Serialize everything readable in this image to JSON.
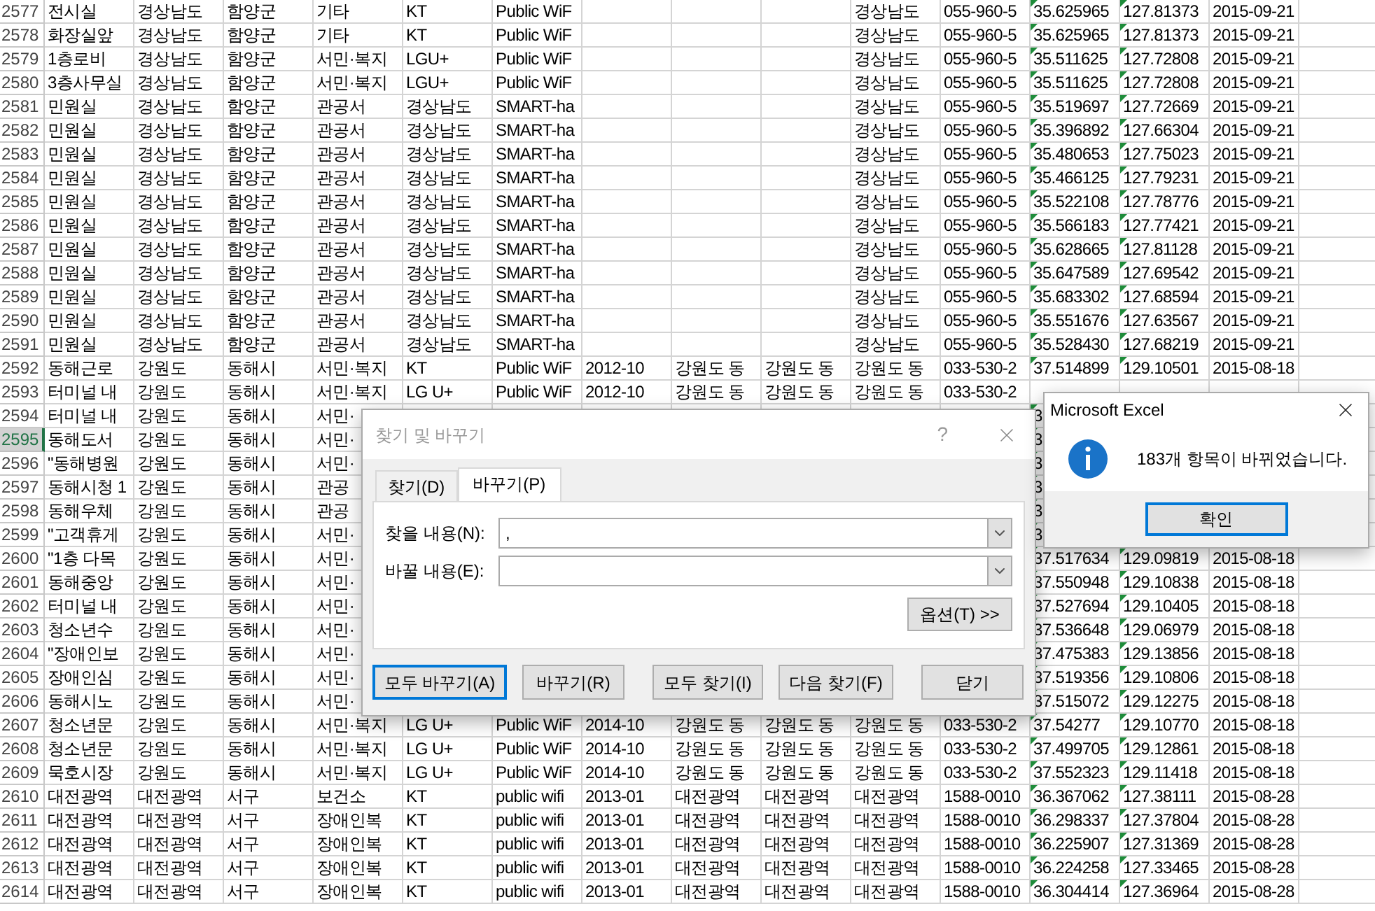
{
  "sheet": {
    "columns": [
      {
        "flagged": false
      },
      {
        "flagged": false
      },
      {
        "flagged": false
      },
      {
        "flagged": false
      },
      {
        "flagged": false
      },
      {
        "flagged": false
      },
      {
        "flagged": false
      },
      {
        "flagged": false
      },
      {
        "flagged": false
      },
      {
        "flagged": false
      },
      {
        "flagged": false
      },
      {
        "flagged": true
      },
      {
        "flagged": true
      },
      {
        "flagged": false
      }
    ],
    "rows": [
      {
        "number": "2577",
        "selected": false,
        "cells": [
          "전시실",
          "경상남도",
          "함양군",
          "기타",
          "KT",
          "Public WiF",
          null,
          null,
          null,
          "경상남도",
          "055-960-5",
          "35.625965",
          "127.81373",
          "2015-09-21"
        ]
      },
      {
        "number": "2578",
        "selected": false,
        "cells": [
          "화장실앞",
          "경상남도",
          "함양군",
          "기타",
          "KT",
          "Public WiF",
          null,
          null,
          null,
          "경상남도",
          "055-960-5",
          "35.625965",
          "127.81373",
          "2015-09-21"
        ]
      },
      {
        "number": "2579",
        "selected": false,
        "cells": [
          "1층로비",
          "경상남도",
          "함양군",
          "서민·복지",
          "LGU+",
          "Public WiF",
          null,
          null,
          null,
          "경상남도",
          "055-960-5",
          "35.511625",
          "127.72808",
          "2015-09-21"
        ]
      },
      {
        "number": "2580",
        "selected": false,
        "cells": [
          "3층사무실",
          "경상남도",
          "함양군",
          "서민·복지",
          "LGU+",
          "Public WiF",
          null,
          null,
          null,
          "경상남도",
          "055-960-5",
          "35.511625",
          "127.72808",
          "2015-09-21"
        ]
      },
      {
        "number": "2581",
        "selected": false,
        "cells": [
          "민원실",
          "경상남도",
          "함양군",
          "관공서",
          "경상남도",
          "SMART-ha",
          null,
          null,
          null,
          "경상남도",
          "055-960-5",
          "35.519697",
          "127.72669",
          "2015-09-21"
        ]
      },
      {
        "number": "2582",
        "selected": false,
        "cells": [
          "민원실",
          "경상남도",
          "함양군",
          "관공서",
          "경상남도",
          "SMART-ha",
          null,
          null,
          null,
          "경상남도",
          "055-960-5",
          "35.396892",
          "127.66304",
          "2015-09-21"
        ]
      },
      {
        "number": "2583",
        "selected": false,
        "cells": [
          "민원실",
          "경상남도",
          "함양군",
          "관공서",
          "경상남도",
          "SMART-ha",
          null,
          null,
          null,
          "경상남도",
          "055-960-5",
          "35.480653",
          "127.75023",
          "2015-09-21"
        ]
      },
      {
        "number": "2584",
        "selected": false,
        "cells": [
          "민원실",
          "경상남도",
          "함양군",
          "관공서",
          "경상남도",
          "SMART-ha",
          null,
          null,
          null,
          "경상남도",
          "055-960-5",
          "35.466125",
          "127.79231",
          "2015-09-21"
        ]
      },
      {
        "number": "2585",
        "selected": false,
        "cells": [
          "민원실",
          "경상남도",
          "함양군",
          "관공서",
          "경상남도",
          "SMART-ha",
          null,
          null,
          null,
          "경상남도",
          "055-960-5",
          "35.522108",
          "127.78776",
          "2015-09-21"
        ]
      },
      {
        "number": "2586",
        "selected": false,
        "cells": [
          "민원실",
          "경상남도",
          "함양군",
          "관공서",
          "경상남도",
          "SMART-ha",
          null,
          null,
          null,
          "경상남도",
          "055-960-5",
          "35.566183",
          "127.77421",
          "2015-09-21"
        ]
      },
      {
        "number": "2587",
        "selected": false,
        "cells": [
          "민원실",
          "경상남도",
          "함양군",
          "관공서",
          "경상남도",
          "SMART-ha",
          null,
          null,
          null,
          "경상남도",
          "055-960-5",
          "35.628665",
          "127.81128",
          "2015-09-21"
        ]
      },
      {
        "number": "2588",
        "selected": false,
        "cells": [
          "민원실",
          "경상남도",
          "함양군",
          "관공서",
          "경상남도",
          "SMART-ha",
          null,
          null,
          null,
          "경상남도",
          "055-960-5",
          "35.647589",
          "127.69542",
          "2015-09-21"
        ]
      },
      {
        "number": "2589",
        "selected": false,
        "cells": [
          "민원실",
          "경상남도",
          "함양군",
          "관공서",
          "경상남도",
          "SMART-ha",
          null,
          null,
          null,
          "경상남도",
          "055-960-5",
          "35.683302",
          "127.68594",
          "2015-09-21"
        ]
      },
      {
        "number": "2590",
        "selected": false,
        "cells": [
          "민원실",
          "경상남도",
          "함양군",
          "관공서",
          "경상남도",
          "SMART-ha",
          null,
          null,
          null,
          "경상남도",
          "055-960-5",
          "35.551676",
          "127.63567",
          "2015-09-21"
        ]
      },
      {
        "number": "2591",
        "selected": false,
        "cells": [
          "민원실",
          "경상남도",
          "함양군",
          "관공서",
          "경상남도",
          "SMART-ha",
          null,
          null,
          null,
          "경상남도",
          "055-960-5",
          "35.528430",
          "127.68219",
          "2015-09-21"
        ]
      },
      {
        "number": "2592",
        "selected": false,
        "cells": [
          "동해근로",
          "강원도",
          "동해시",
          "서민·복지",
          "KT",
          "Public WiF",
          "2012-10",
          "강원도 동",
          "강원도 동",
          "강원도 동",
          "033-530-2",
          "37.514899",
          "129.10501",
          "2015-08-18"
        ]
      },
      {
        "number": "2593",
        "selected": false,
        "cells": [
          "터미널 내",
          "강원도",
          "동해시",
          "서민·복지",
          "LG U+",
          "Public WiF",
          "2012-10",
          "강원도 동",
          "강원도 동",
          "강원도 동",
          "033-530-2",
          null,
          null,
          null
        ]
      },
      {
        "number": "2594",
        "selected": false,
        "cells": [
          "터미널 내",
          "강원도",
          "동해시",
          "서민·",
          null,
          null,
          null,
          null,
          null,
          null,
          null,
          "3",
          null,
          null
        ]
      },
      {
        "number": "2595",
        "selected": true,
        "cells": [
          "동해도서",
          "강원도",
          "동해시",
          "서민·",
          null,
          null,
          null,
          null,
          null,
          null,
          null,
          "3",
          null,
          null
        ]
      },
      {
        "number": "2596",
        "selected": false,
        "cells": [
          "\"동해병원",
          "강원도",
          "동해시",
          "서민·",
          null,
          null,
          null,
          null,
          null,
          null,
          null,
          "3",
          null,
          null
        ]
      },
      {
        "number": "2597",
        "selected": false,
        "cells": [
          "동해시청 1",
          "강원도",
          "동해시",
          "관공",
          null,
          null,
          null,
          null,
          null,
          null,
          null,
          "3",
          null,
          null
        ]
      },
      {
        "number": "2598",
        "selected": false,
        "cells": [
          "동해우체",
          "강원도",
          "동해시",
          "관공",
          null,
          null,
          null,
          null,
          null,
          null,
          null,
          "3",
          null,
          null
        ]
      },
      {
        "number": "2599",
        "selected": false,
        "cells": [
          "\"고객휴게",
          "강원도",
          "동해시",
          "서민·",
          null,
          null,
          null,
          null,
          null,
          null,
          null,
          "3",
          null,
          null
        ]
      },
      {
        "number": "2600",
        "selected": false,
        "cells": [
          "\"1층 다목",
          "강원도",
          "동해시",
          "서민·",
          null,
          null,
          null,
          null,
          null,
          null,
          null,
          "37.517634",
          "129.09819",
          "2015-08-18"
        ]
      },
      {
        "number": "2601",
        "selected": false,
        "cells": [
          "동해중앙",
          "강원도",
          "동해시",
          "서민·",
          null,
          null,
          null,
          null,
          null,
          null,
          null,
          "37.550948",
          "129.10838",
          "2015-08-18"
        ]
      },
      {
        "number": "2602",
        "selected": false,
        "cells": [
          "터미널 내",
          "강원도",
          "동해시",
          "서민·",
          null,
          null,
          null,
          null,
          null,
          null,
          null,
          "37.527694",
          "129.10405",
          "2015-08-18"
        ]
      },
      {
        "number": "2603",
        "selected": false,
        "cells": [
          "청소년수",
          "강원도",
          "동해시",
          "서민·",
          null,
          null,
          null,
          null,
          null,
          null,
          null,
          "37.536648",
          "129.06979",
          "2015-08-18"
        ]
      },
      {
        "number": "2604",
        "selected": false,
        "cells": [
          "\"장애인보",
          "강원도",
          "동해시",
          "서민·",
          null,
          null,
          null,
          null,
          null,
          null,
          null,
          "37.475383",
          "129.13856",
          "2015-08-18"
        ]
      },
      {
        "number": "2605",
        "selected": false,
        "cells": [
          "장애인심",
          "강원도",
          "동해시",
          "서민·",
          null,
          null,
          null,
          null,
          null,
          null,
          null,
          "37.519356",
          "129.10806",
          "2015-08-18"
        ]
      },
      {
        "number": "2606",
        "selected": false,
        "cells": [
          "동해시노",
          "강원도",
          "동해시",
          "서민·",
          null,
          null,
          null,
          null,
          null,
          null,
          null,
          "37.515072",
          "129.12275",
          "2015-08-18"
        ]
      },
      {
        "number": "2607",
        "selected": false,
        "cells": [
          "청소년문",
          "강원도",
          "동해시",
          "서민·복지",
          "LG U+",
          "Public WiF",
          "2014-10",
          "강원도 동",
          "강원도 동",
          "강원도 동",
          "033-530-2",
          "37.54277",
          "129.10770",
          "2015-08-18"
        ]
      },
      {
        "number": "2608",
        "selected": false,
        "cells": [
          "청소년문",
          "강원도",
          "동해시",
          "서민·복지",
          "LG U+",
          "Public WiF",
          "2014-10",
          "강원도 동",
          "강원도 동",
          "강원도 동",
          "033-530-2",
          "37.499705",
          "129.12861",
          "2015-08-18"
        ]
      },
      {
        "number": "2609",
        "selected": false,
        "cells": [
          "묵호시장",
          "강원도",
          "동해시",
          "서민·복지",
          "LG U+",
          "Public WiF",
          "2014-10",
          "강원도 동",
          "강원도 동",
          "강원도 동",
          "033-530-2",
          "37.552323",
          "129.11418",
          "2015-08-18"
        ]
      },
      {
        "number": "2610",
        "selected": false,
        "cells": [
          "대전광역",
          "대전광역",
          "서구",
          "보건소",
          "KT",
          "public wifi",
          "2013-01",
          "대전광역",
          "대전광역",
          "대전광역",
          "1588-0010",
          "36.367062",
          "127.38111",
          "2015-08-28"
        ]
      },
      {
        "number": "2611",
        "selected": false,
        "cells": [
          "대전광역",
          "대전광역",
          "서구",
          "장애인복",
          "KT",
          "public wifi",
          "2013-01",
          "대전광역",
          "대전광역",
          "대전광역",
          "1588-0010",
          "36.298337",
          "127.37804",
          "2015-08-28"
        ]
      },
      {
        "number": "2612",
        "selected": false,
        "cells": [
          "대전광역",
          "대전광역",
          "서구",
          "장애인복",
          "KT",
          "public wifi",
          "2013-01",
          "대전광역",
          "대전광역",
          "대전광역",
          "1588-0010",
          "36.225907",
          "127.31369",
          "2015-08-28"
        ]
      },
      {
        "number": "2613",
        "selected": false,
        "cells": [
          "대전광역",
          "대전광역",
          "서구",
          "장애인복",
          "KT",
          "public wifi",
          "2013-01",
          "대전광역",
          "대전광역",
          "대전광역",
          "1588-0010",
          "36.224258",
          "127.33465",
          "2015-08-28"
        ]
      },
      {
        "number": "2614",
        "selected": false,
        "cells": [
          "대전광역",
          "대전광역",
          "서구",
          "장애인복",
          "KT",
          "public wifi",
          "2013-01",
          "대전광역",
          "대전광역",
          "대전광역",
          "1588-0010",
          "36.304414",
          "127.36964",
          "2015-08-28"
        ]
      }
    ]
  },
  "find_dialog": {
    "title": "찾기 및 바꾸기",
    "help": "?",
    "tabs": [
      {
        "label": "찾기(D)",
        "selected": false
      },
      {
        "label": "바꾸기(P)",
        "selected": true
      }
    ],
    "fields": [
      {
        "label": "찾을 내용(N):",
        "value": ","
      },
      {
        "label": "바꿀 내용(E):"
      }
    ],
    "options_button": "옵션(T) >>",
    "buttons": [
      {
        "label": "모두 바꾸기(A)",
        "default": true
      },
      {
        "label": "바꾸기(R)",
        "default": false
      },
      {
        "label": "모두 찾기(I)",
        "default": false
      },
      {
        "label": "다음 찾기(F)",
        "default": false
      },
      {
        "label": "닫기",
        "default": false
      }
    ]
  },
  "message_box": {
    "title": "Microsoft Excel",
    "message": "183개 항목이 바뀌었습니다.",
    "button": {
      "label": "확인",
      "focused": true
    }
  }
}
